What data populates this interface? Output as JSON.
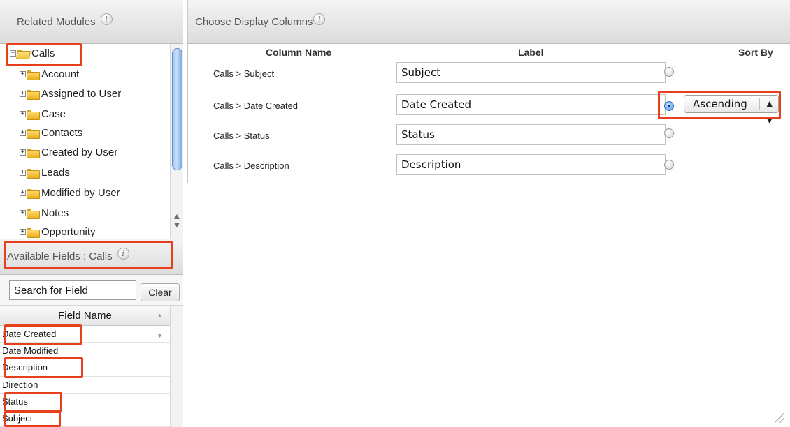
{
  "related_modules": {
    "title": "Related Modules",
    "root": "Calls",
    "items": [
      "Account",
      "Assigned to User",
      "Case",
      "Contacts",
      "Created by User",
      "Leads",
      "Modified by User",
      "Notes",
      "Opportunity"
    ]
  },
  "available_fields": {
    "title": "Available Fields : Calls",
    "search_value": "Search for Field",
    "clear_label": "Clear",
    "column_header": "Field Name",
    "fields": [
      "Date Created",
      "Date Modified",
      "Description",
      "Direction",
      "Status",
      "Subject"
    ]
  },
  "display_columns": {
    "title": "Choose Display Columns",
    "headers": {
      "column_name": "Column Name",
      "label": "Label",
      "sort_by": "Sort By"
    },
    "rows": [
      {
        "column": "Calls > Subject",
        "label": "Subject",
        "sort_selected": false
      },
      {
        "column": "Calls > Date Created",
        "label": "Date Created",
        "sort_selected": true
      },
      {
        "column": "Calls > Status",
        "label": "Status",
        "sort_selected": false
      },
      {
        "column": "Calls > Description",
        "label": "Description",
        "sort_selected": false
      }
    ],
    "sort_value": "Ascending"
  },
  "icons": {
    "info": "info-icon",
    "folder": "folder-icon",
    "expand": "expand-plus-icon",
    "collapse": "collapse-minus-icon"
  },
  "colors": {
    "highlight": "#e8401c",
    "folder": "#f0c030"
  }
}
